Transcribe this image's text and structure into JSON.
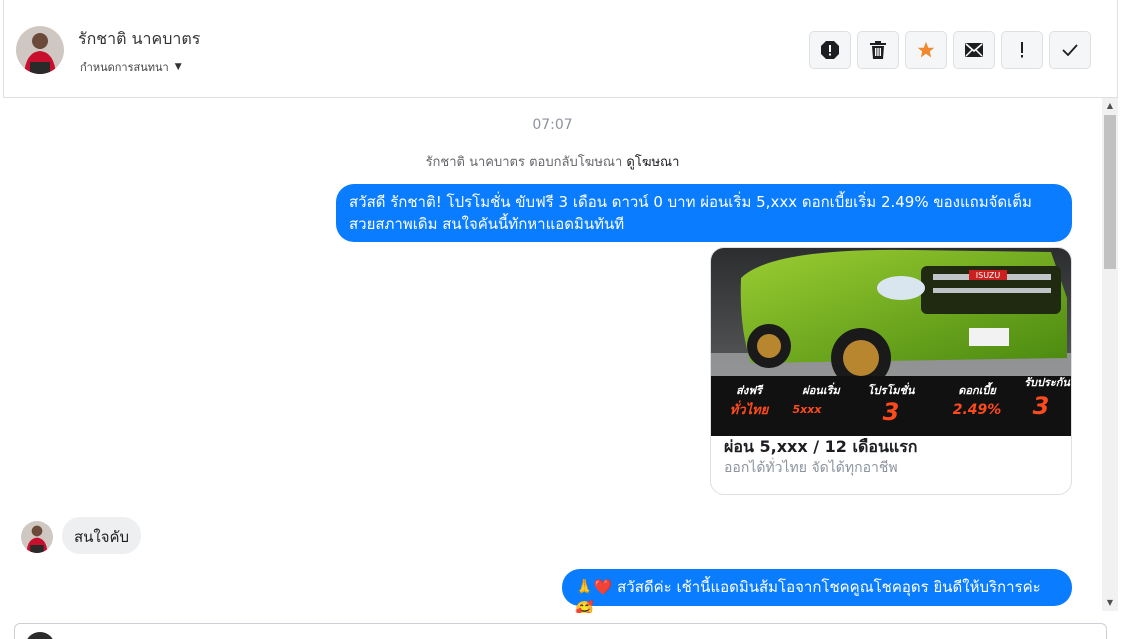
{
  "header": {
    "contact_name": "รักชาติ นาคบาตร",
    "assign_label": "กำหนดการสนทนา",
    "actions": [
      {
        "name": "report-icon"
      },
      {
        "name": "trash-icon"
      },
      {
        "name": "star-icon",
        "color": "#f0892d"
      },
      {
        "name": "envelope-icon"
      },
      {
        "name": "exclamation-icon"
      },
      {
        "name": "check-icon"
      }
    ]
  },
  "conversation": {
    "timestamp": "07:07",
    "ad_reply_text": "รักชาติ นาคบาตร ตอบกลับโฆษณา",
    "ad_reply_link": "ดูโฆษณา",
    "messages": [
      {
        "direction": "outgoing",
        "text": "สวัสดี รักชาติ! โปรโมชั่น ขับฟรี 3 เดือน ดาวน์ 0 บาท ผ่อนเริ่ม 5,xxx  ดอกเบี้ยเริ่ม 2.49% ของแถมจัดเต็ม สวยสภาพเดิม สนใจคันนี้ทักหาแอดมินทันที"
      },
      {
        "direction": "incoming",
        "text": "สนใจคับ"
      },
      {
        "direction": "outgoing",
        "text": "🙏❤️ สวัสดีค่ะ เช้านี้แอดมินส้มโอจากโชคคูณโชคอุดร ยินดีให้บริการค่ะ 🥰."
      }
    ],
    "card": {
      "title": "ผ่อน 5,xxx / 12 เดือนแรก",
      "subtitle": "ออกได้ทั่วไทย จัดได้ทุกอาชีพ",
      "brand_badge": "ISUZU",
      "promo_items": [
        {
          "top": "ส่งฟรี",
          "bottom": "ทั่วไทย"
        },
        {
          "top": "ผ่อนเริ่ม",
          "bottom": "5xxx"
        },
        {
          "top": "โปรโมชั่น",
          "bottom": "3"
        },
        {
          "top": "ดอกเบี้ย",
          "bottom": "2.49%"
        },
        {
          "top": "รับประกัน",
          "bottom": "3"
        }
      ]
    }
  },
  "colors": {
    "accent": "#0a7cff",
    "incoming_bubble": "#eeeff1",
    "star": "#f0892d"
  }
}
